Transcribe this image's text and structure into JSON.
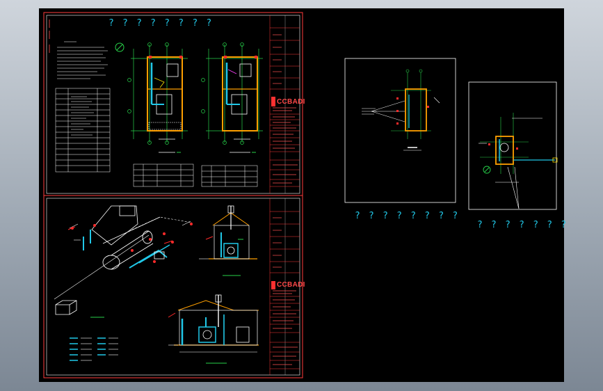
{
  "drawing": {
    "sheet_top_title": "? ? ? ? ? ? ? ?",
    "detail_caption_left": "? ? ? ? ? ? ? ?",
    "detail_caption_right": "? ? ? ? ? ? ?",
    "logo_top": "CCBADI",
    "logo_bottom": "CCBADI"
  },
  "colors": {
    "background": "#000000",
    "frame_red": "#ff3b3b",
    "border_white": "#ffffff",
    "cyan": "#21c8e8",
    "green": "#27d24a",
    "yellow": "#ffe400",
    "orange": "#ffa000",
    "magenta": "#ff40ff",
    "red": "#ff2a2a"
  }
}
